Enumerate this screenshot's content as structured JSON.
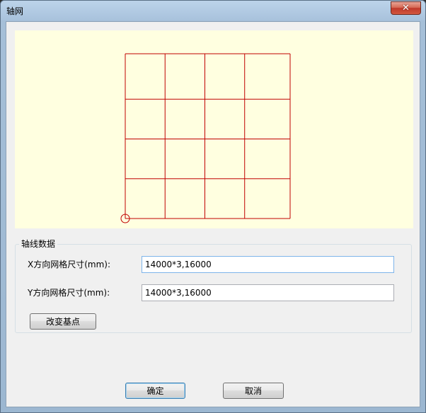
{
  "window": {
    "title": "轴网",
    "close_symbol": "✕"
  },
  "preview": {
    "background_color": "#ffffe0",
    "grid_color": "#c00000",
    "x_spacings_mm": [
      14000,
      14000,
      14000,
      16000
    ],
    "y_spacings_mm": [
      14000,
      14000,
      14000,
      16000
    ]
  },
  "axis_group": {
    "title": "轴线数据",
    "x_label": "X方向网格尺寸(mm):",
    "x_value": "14000*3,16000",
    "y_label": "Y方向网格尺寸(mm):",
    "y_value": "14000*3,16000",
    "change_base_button": "改变基点"
  },
  "footer": {
    "ok_button": "确定",
    "cancel_button": "取消"
  }
}
